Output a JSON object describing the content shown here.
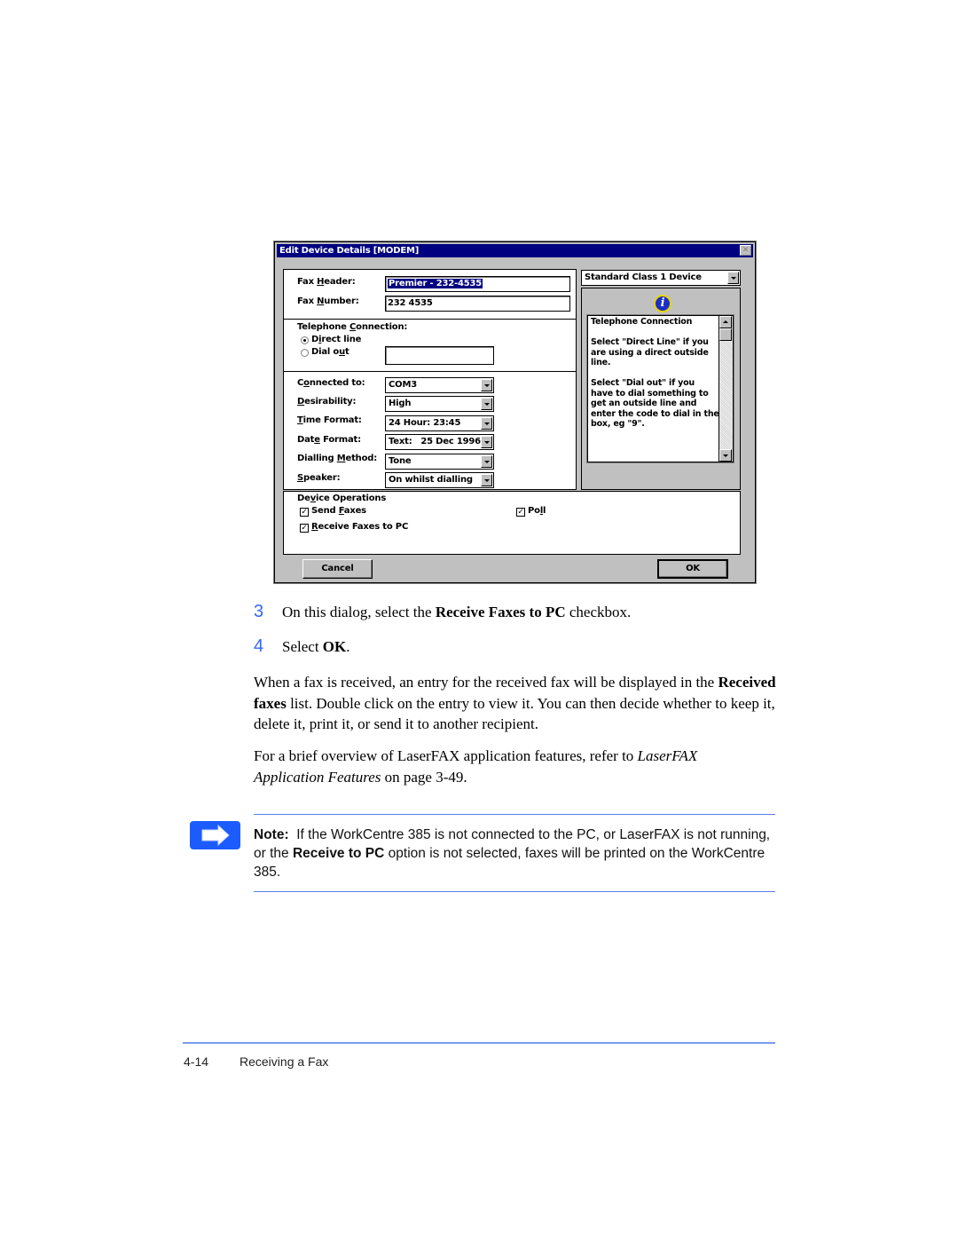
{
  "dialog": {
    "title": "Edit Device Details [MODEM]",
    "close_icon": "close-x",
    "fax_header_label_pre": "Fax ",
    "fax_header_label_u": "H",
    "fax_header_label_post": "eader:",
    "fax_header_value": "Premier - 232-4535",
    "fax_number_label_pre": "Fax ",
    "fax_number_label_u": "N",
    "fax_number_label_post": "umber:",
    "fax_number_value": "232 4535",
    "device_type": "Standard Class 1 Device",
    "telephone_connection_label_pre": "Telephone ",
    "telephone_connection_label_u": "C",
    "telephone_connection_label_post": "onnection:",
    "radio_direct_pre": "D",
    "radio_direct_u": "i",
    "radio_direct_post": "rect line",
    "radio_dialout_pre": "Dial o",
    "radio_dialout_u": "u",
    "radio_dialout_post": "t",
    "dial_out_code": "",
    "selected_connection": "Direct line",
    "fields": [
      {
        "pre": "C",
        "u": "o",
        "post": "nnected to:",
        "value": "COM3"
      },
      {
        "pre": "",
        "u": "D",
        "post": "esirability:",
        "value": "High"
      },
      {
        "pre": "",
        "u": "T",
        "post": "ime Format:",
        "value": "24 Hour: 23:45"
      },
      {
        "pre": "Dat",
        "u": "e",
        "post": " Format:",
        "value": "Text:   25 Dec 1996"
      },
      {
        "pre": "Dialling ",
        "u": "M",
        "post": "ethod:",
        "value": "Tone"
      },
      {
        "pre": "",
        "u": "S",
        "post": "peaker:",
        "value": "On whilst dialling"
      }
    ],
    "device_operations_pre": "De",
    "device_operations_u": "v",
    "device_operations_post": "ice Operations",
    "send_faxes_pre": "Send ",
    "send_faxes_u": "F",
    "send_faxes_post": "axes",
    "send_faxes_checked": true,
    "poll_pre": "Po",
    "poll_u": "l",
    "poll_post": "l",
    "poll_checked": true,
    "receive_pre": "",
    "receive_u": "R",
    "receive_post": "eceive Faxes to PC",
    "receive_checked": true,
    "check_mark": "✓",
    "help_icon": "info-i",
    "help_text": "Telephone Connection\n\nSelect \"Direct Line\" if you are using a direct outside line.\n\nSelect \"Dial out\" if you have to dial something to get an outside line and enter the code to dial in the box, eg \"9\".",
    "cancel_label": "Cancel",
    "ok_label": "OK"
  },
  "steps": [
    {
      "num": "3",
      "pre": "On this dialog, select the ",
      "bold": "Receive Faxes to PC",
      "post": " checkbox."
    },
    {
      "num": "4",
      "pre": "Select ",
      "bold": "OK",
      "post": "."
    }
  ],
  "paragraphs": {
    "p1_bold": "Received faxes",
    "p1_pre": "When a fax is received, an entry for the received fax will be displayed in the ",
    "p1_post": " list.  Double click on the entry to view it.  You can then decide whether to keep it, delete it, print it, or send it to another recipient.",
    "p2_pre": "For a brief overview of LaserFAX application features, refer to ",
    "p2_italic": "LaserFAX Application Features",
    "p2_post": " on page 3-49."
  },
  "note": {
    "icon": "arrow-right",
    "label": "Note:",
    "pre": "  If the WorkCentre 385 is not connected to the PC, or LaserFAX is not running, or the ",
    "bold": "Receive to PC",
    "post": " option is not selected, faxes will be printed on the WorkCentre 385."
  },
  "footer": {
    "page_number": "4-14",
    "section": "Receiving a Fax"
  },
  "colors": {
    "accent_blue": "#3366ff",
    "rule_blue": "#5a7fe6",
    "titlebar": "#000080"
  }
}
